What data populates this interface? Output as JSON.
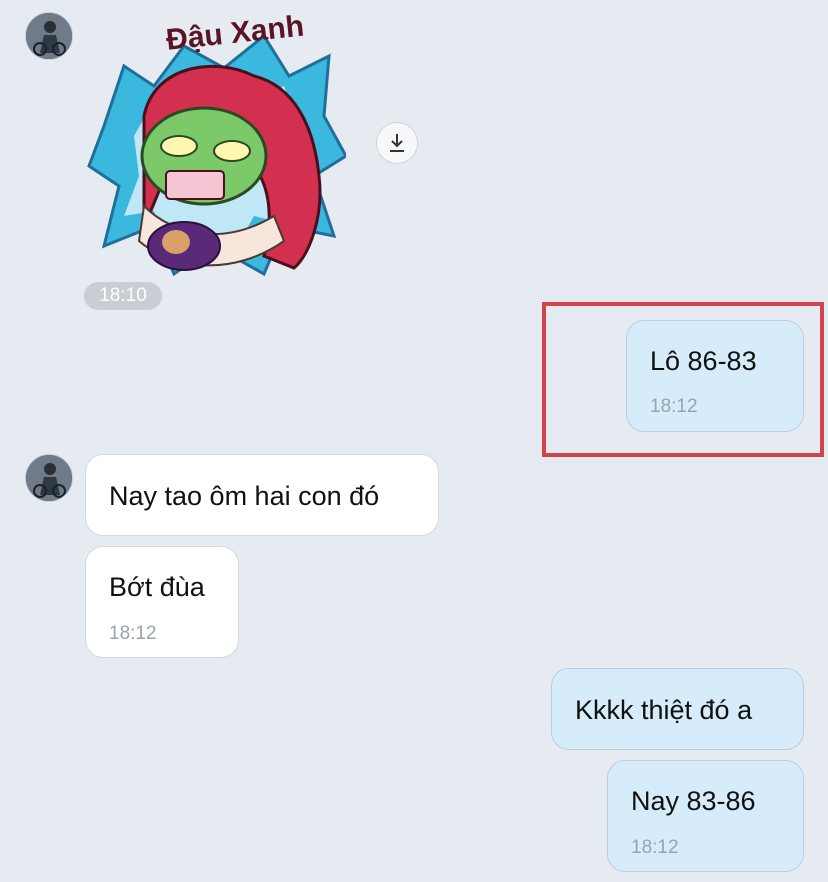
{
  "sticker": {
    "caption": "Đậu Xanh",
    "time": "18:10",
    "icon": "download-icon"
  },
  "messages": [
    {
      "id": "m1",
      "side": "out",
      "text": "Lô 86-83",
      "time": "18:12",
      "highlighted": true
    },
    {
      "id": "m2",
      "side": "in",
      "text": "Nay tao ôm hai con đó"
    },
    {
      "id": "m3",
      "side": "in",
      "text": "Bớt đùa",
      "time": "18:12"
    },
    {
      "id": "m4",
      "side": "out",
      "text": "Kkkk thiệt đó a"
    },
    {
      "id": "m5",
      "side": "out",
      "text": "Nay 83-86",
      "time": "18:12"
    }
  ],
  "colors": {
    "background": "#e6eaf1",
    "incoming_bubble": "#ffffff",
    "outgoing_bubble": "#d6ecfb",
    "highlight_border": "#d0454b",
    "timestamp": "#9aa3ad"
  }
}
